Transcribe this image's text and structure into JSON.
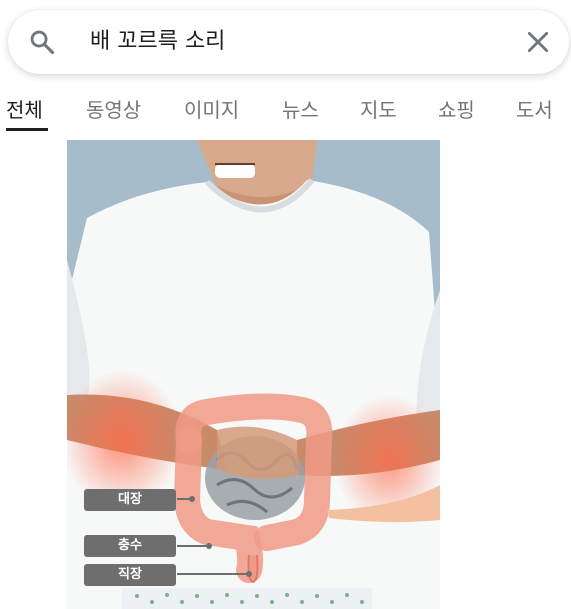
{
  "search": {
    "query": "배 꼬르륵 소리"
  },
  "tabs": [
    {
      "label": "전체",
      "active": true
    },
    {
      "label": "동영상",
      "active": false
    },
    {
      "label": "이미지",
      "active": false
    },
    {
      "label": "뉴스",
      "active": false
    },
    {
      "label": "지도",
      "active": false
    },
    {
      "label": "쇼핑",
      "active": false
    },
    {
      "label": "도서",
      "active": false
    }
  ],
  "image_labels": {
    "large_intestine": "대장",
    "jejunum": "충수",
    "rectum": "직장"
  },
  "colors": {
    "active_tab": "#1f1f1f",
    "inactive_tab": "#70757a",
    "image_background": "#a9bccb",
    "label_box": "#6e6e6e"
  },
  "icons": {
    "search": "search-icon",
    "clear": "close-icon"
  }
}
